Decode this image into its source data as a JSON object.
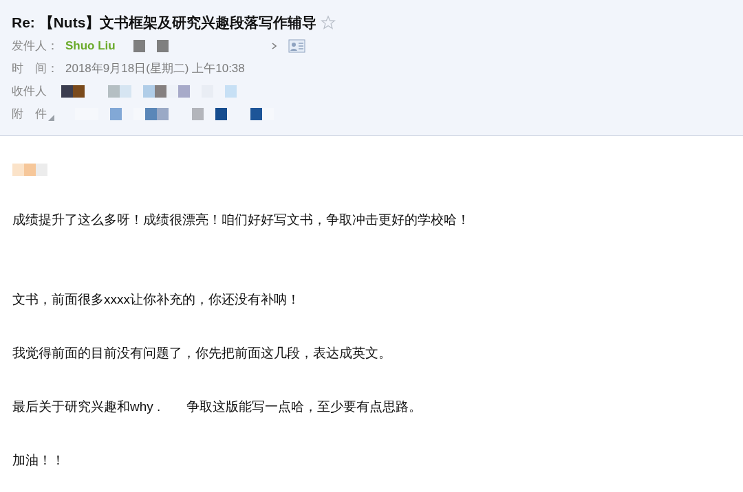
{
  "header": {
    "subject": "Re: 【Nuts】文书框架及研究兴趣段落写作辅导",
    "starred": false,
    "fields": [
      {
        "kind": "sender",
        "label": "发件人：",
        "value": "Shuo Liu"
      },
      {
        "kind": "time",
        "label": "时　间：",
        "value": "2018年9月18日(星期二) 上午10:38"
      },
      {
        "kind": "recipients",
        "label": "收件人"
      },
      {
        "kind": "attachments",
        "label": "附　件"
      }
    ]
  },
  "body": {
    "paragraphs": [
      {
        "kind": "redacted"
      },
      {
        "kind": "text",
        "text": "成绩提升了这么多呀！成绩很漂亮！咱们好好写文书，争取冲击更好的学校哈！"
      },
      {
        "kind": "spacer"
      },
      {
        "kind": "text",
        "text": "文书，前面很多xxxx让你补充的，你还没有补呐！"
      },
      {
        "kind": "text",
        "text": "我觉得前面的目前没有问题了，你先把前面这几段，表达成英文。"
      },
      {
        "kind": "text",
        "text": "最后关于研究兴趣和why .　　争取这版能写一点哈，至少要有点思路。"
      },
      {
        "kind": "text",
        "text": "加油！！"
      }
    ]
  }
}
